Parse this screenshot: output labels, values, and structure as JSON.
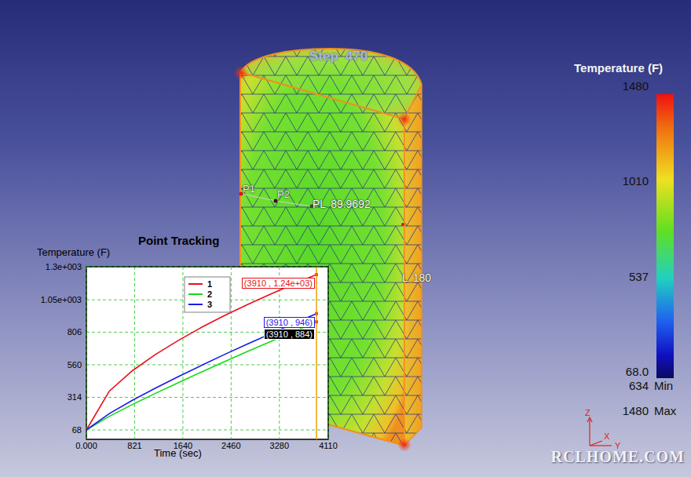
{
  "viewport": {
    "step_label": "Step",
    "step": "470"
  },
  "probes": [
    {
      "label": "P1"
    },
    {
      "label": "P2"
    }
  ],
  "measurements": [
    {
      "label": "PL",
      "value": "89.9692"
    },
    {
      "label": "L",
      "value": "180"
    }
  ],
  "legend": {
    "title": "Temperature (F)",
    "ticks": [
      "1480",
      "1010",
      "537",
      "68.0"
    ],
    "min": {
      "value": "634",
      "label": "Min"
    },
    "max": {
      "value": "1480",
      "label": "Max"
    }
  },
  "axes_triad": [
    "Z",
    "X",
    "Y"
  ],
  "watermark": "RCLHOME.COM",
  "chart": {
    "title": "Point Tracking",
    "y_axis": {
      "label": "Temperature (F)",
      "ticks": [
        "1.3e+003",
        "1.05e+003",
        "806",
        "560",
        "314",
        "68"
      ]
    },
    "x_axis": {
      "label": "Time (sec)",
      "ticks": [
        "0.000",
        "821",
        "1640",
        "2460",
        "3280",
        "4110"
      ]
    },
    "cursor_time": 3910,
    "times": [
      0,
      391,
      782,
      1173,
      1564,
      1955,
      2346,
      2737,
      3128,
      3519,
      3910
    ],
    "series": [
      {
        "name": "1",
        "color": "#e8101a",
        "readout": "(3910 , 1.24e+03)",
        "highlighted": false,
        "values": [
          68,
          362,
          515,
          638,
          744,
          842,
          931,
          1014,
          1093,
          1168,
          1240
        ]
      },
      {
        "name": "2",
        "color": "#18d818",
        "readout": "(3910 , 884)",
        "highlighted": true,
        "values": [
          68,
          171,
          260,
          344,
          425,
          505,
          583,
          660,
          735,
          810,
          884
        ]
      },
      {
        "name": "3",
        "color": "#1a1ae8",
        "readout": "(3910 , 946)",
        "highlighted": false,
        "values": [
          68,
          192,
          292,
          383,
          471,
          555,
          637,
          717,
          794,
          870,
          946
        ]
      }
    ]
  }
}
